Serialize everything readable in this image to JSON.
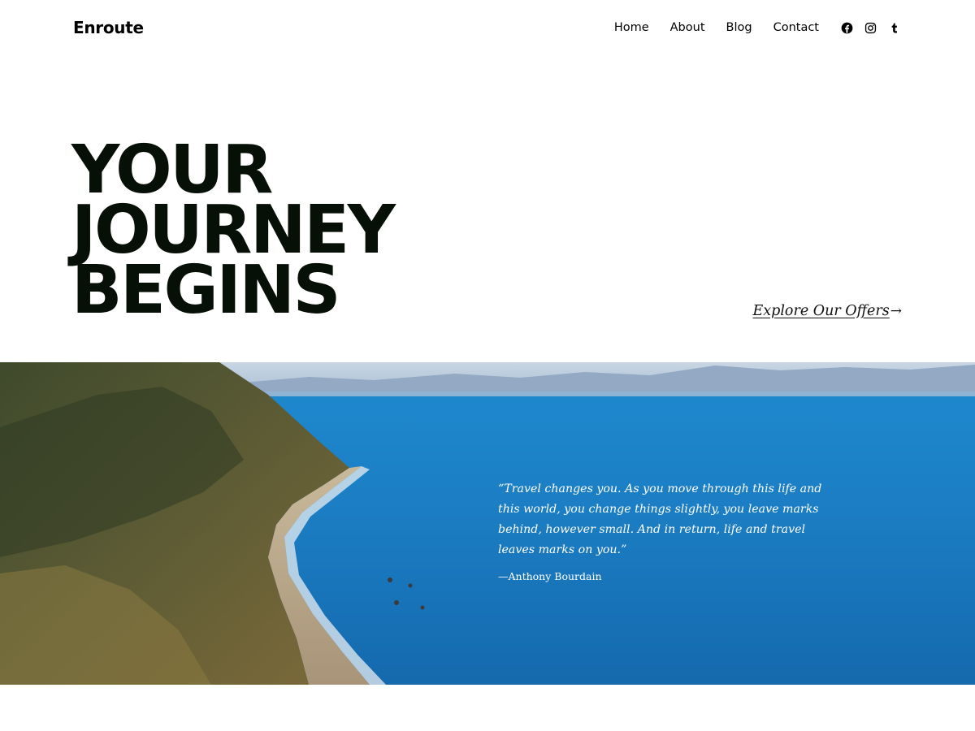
{
  "site": {
    "title": "Enroute"
  },
  "nav": {
    "items": [
      "Home",
      "About",
      "Blog",
      "Contact"
    ]
  },
  "social": [
    {
      "name": "Facebook",
      "icon": "facebook-icon"
    },
    {
      "name": "Instagram",
      "icon": "instagram-icon"
    },
    {
      "name": "Tumblr",
      "icon": "tumblr-icon"
    }
  ],
  "hero": {
    "title_lines": [
      "YOUR",
      "JOURNEY",
      "BEGINS"
    ]
  },
  "cta": {
    "label": "Explore Our Offers",
    "arrow": "→"
  },
  "cover": {
    "quote": "“Travel changes you. As you move through this life and this world, you change things slightly, you leave marks behind, however small. And in return, life and travel leaves marks on you.”",
    "citation": "—Anthony Bourdain"
  },
  "colors": {
    "text": "#071007",
    "sea": "#1b7cc2",
    "background": "#ffffff"
  }
}
